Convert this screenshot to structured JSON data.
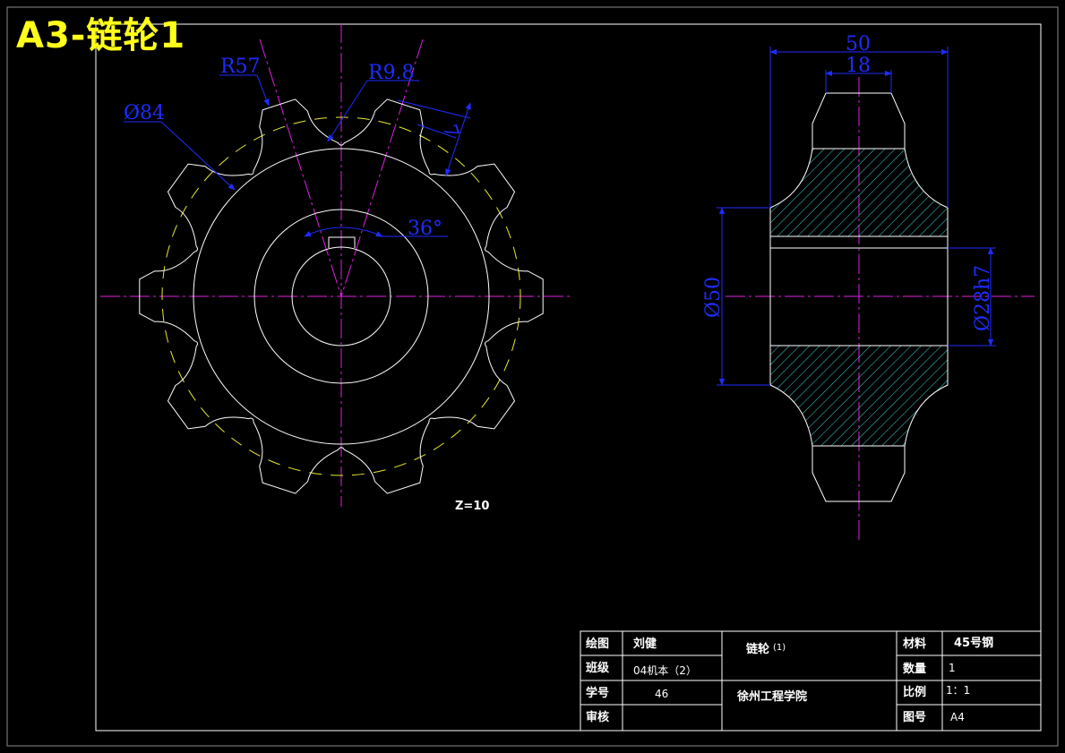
{
  "sheet_title": "A3-链轮1",
  "dimensions": {
    "r57": "R57",
    "r98": "R9.8",
    "d84": "Ø84",
    "seven": "7",
    "angle": "36°",
    "fifty_top": "50",
    "eighteen": "18",
    "d50": "Ø50",
    "d28h7": "Ø28h7"
  },
  "teeth_label": "Z=10",
  "title_block": {
    "drawn_label": "绘图",
    "drawn_value": "刘健",
    "part_name": "链轮",
    "part_suffix": "(1)",
    "material_label": "材料",
    "material_value": "45号钢",
    "class_label": "班级",
    "class_value": "04机本（2）",
    "quantity_label": "数量",
    "quantity_value": "1",
    "student_no_label": "学号",
    "student_no_value": "46",
    "school": "徐州工程学院",
    "scale_label": "比例",
    "scale_value": "1：1",
    "review_label": "审核",
    "drawing_no_label": "图号",
    "drawing_no_value": "A4"
  },
  "colors": {
    "background": "#000000",
    "outline": "#ffffff",
    "center_line": "#e020e0",
    "dimension": "#1f2cff",
    "pitch_circle": "#e8e830",
    "hatch": "#3fd0d0",
    "title": "#ffff1a"
  }
}
